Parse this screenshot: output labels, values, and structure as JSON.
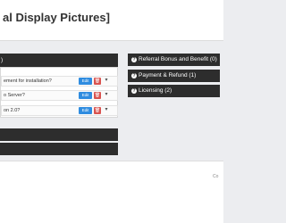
{
  "header": {
    "title": "al Display Pictures]"
  },
  "left_panel": {
    "header_label": ")",
    "questions": [
      {
        "text": "ement for installation?",
        "edit_label": "Edit",
        "delete_label": "🗑"
      },
      {
        "text": "o Server?",
        "edit_label": "Edit",
        "delete_label": "🗑"
      },
      {
        "text": "on 2.0?",
        "edit_label": "Edit",
        "delete_label": "🗑"
      }
    ],
    "bar2_label": "",
    "bar3_label": ""
  },
  "right_panel": {
    "categories": [
      {
        "label": "Referral Bonus and Benefit (0)"
      },
      {
        "label": "Payment & Refund (1)"
      },
      {
        "label": "Licensing (2)"
      }
    ]
  },
  "footer": {
    "text": "Co"
  },
  "colors": {
    "bar": "#2d2d2d",
    "edit": "#2f8ce0",
    "delete": "#d9534f"
  }
}
